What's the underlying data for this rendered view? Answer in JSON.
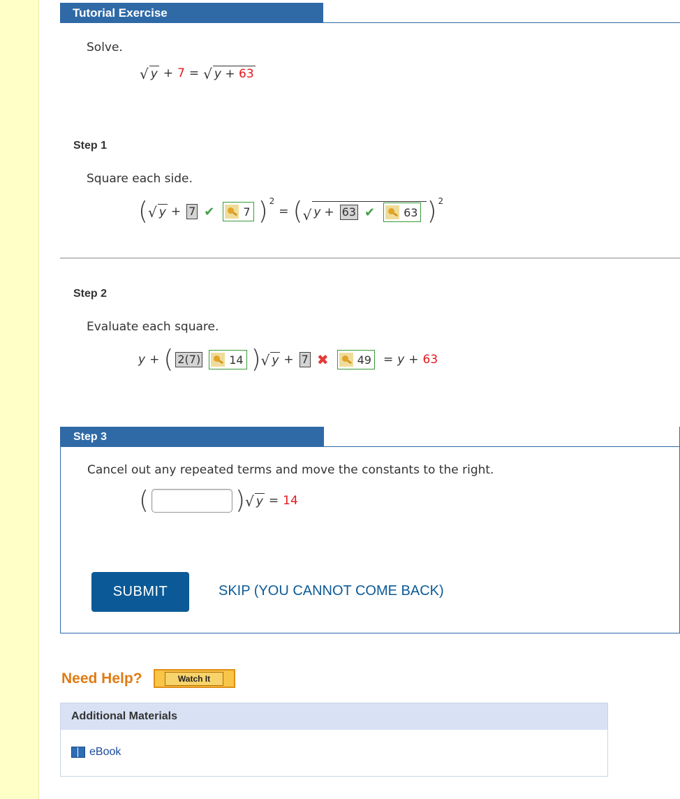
{
  "header": {
    "tab_title": "Tutorial Exercise"
  },
  "problem": {
    "instruction": "Solve.",
    "eq_var": "y",
    "eq_plus": "+",
    "eq_const": "7",
    "eq_equals": "=",
    "eq_rhs_var": "y",
    "eq_rhs_plus": "+",
    "eq_rhs_const": "63"
  },
  "step1": {
    "label": "Step 1",
    "instruction": "Square each side.",
    "var": "y",
    "plus": "+",
    "input1": "7",
    "answer1": "7",
    "exp": "2",
    "equals": "=",
    "rhs_var": "y",
    "rhs_plus": "+",
    "input2": "63",
    "answer2": "63",
    "exp2": "2",
    "status1": "correct",
    "status2": "correct"
  },
  "step2": {
    "label": "Step 2",
    "instruction": "Evaluate each square.",
    "var": "y",
    "plus": "+",
    "input1": "2(7)",
    "answer1": "14",
    "sqrt_var": "y",
    "plus2": "+",
    "input2": "7",
    "answer2": "49",
    "equals": "=",
    "rhs_var": "y",
    "rhs_plus": "+",
    "rhs_const": "63",
    "status2": "incorrect"
  },
  "step3": {
    "label": "Step 3",
    "instruction": "Cancel out any repeated terms and move the constants to the right.",
    "input_value": "",
    "sqrt_var": "y",
    "equals": "=",
    "rhs_const": "14",
    "submit_label": "SUBMIT",
    "skip_label": "SKIP (YOU CANNOT COME BACK)"
  },
  "help": {
    "title": "Need Help?",
    "watch_label": "Watch It"
  },
  "additional": {
    "title": "Additional Materials",
    "ebook_label": "eBook"
  },
  "colors": {
    "header_blue": "#2f6aa7",
    "submit_blue": "#0b5a97",
    "help_orange": "#e07b14",
    "red_value": "#e3191c",
    "correct_green": "#43a047",
    "incorrect_red": "#e53935",
    "sidebar_yellow": "#ffffc8"
  },
  "icons": [
    "check-icon",
    "x-icon",
    "key-icon",
    "book-icon"
  ]
}
